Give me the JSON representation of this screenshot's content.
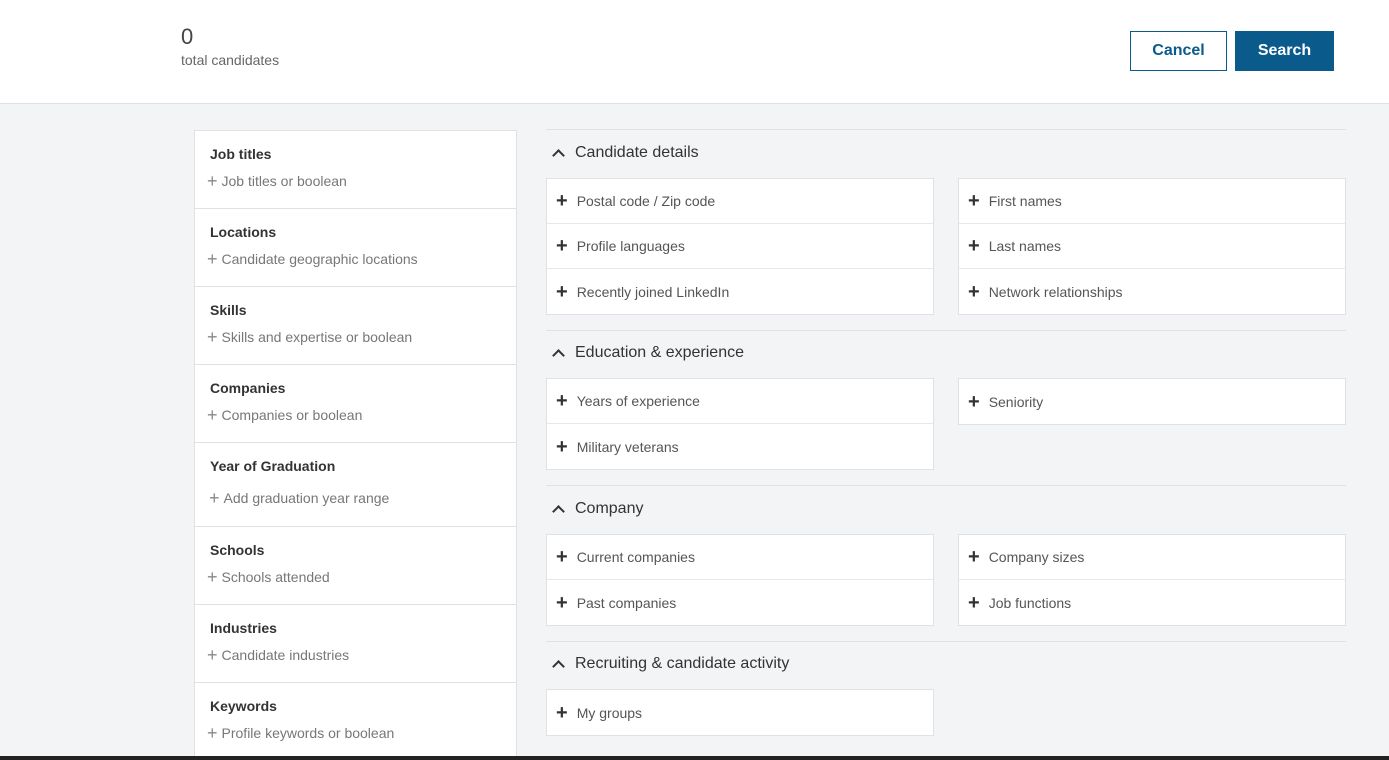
{
  "header": {
    "total_count": "0",
    "total_label": "total candidates",
    "cancel_label": "Cancel",
    "search_label": "Search"
  },
  "filters": [
    {
      "title": "Job titles",
      "placeholder": "Job titles or boolean"
    },
    {
      "title": "Locations",
      "placeholder": "Candidate geographic locations"
    },
    {
      "title": "Skills",
      "placeholder": "Skills and expertise or boolean"
    },
    {
      "title": "Companies",
      "placeholder": "Companies or boolean"
    },
    {
      "title": "Year of Graduation",
      "placeholder": "Add graduation year range"
    },
    {
      "title": "Schools",
      "placeholder": "Schools attended"
    },
    {
      "title": "Industries",
      "placeholder": "Candidate industries"
    },
    {
      "title": "Keywords",
      "placeholder": "Profile keywords or boolean"
    }
  ],
  "sections": {
    "candidate_details": {
      "title": "Candidate details",
      "left": [
        "Postal code / Zip code",
        "Profile languages",
        "Recently joined LinkedIn"
      ],
      "right": [
        "First names",
        "Last names",
        "Network relationships"
      ]
    },
    "education": {
      "title": "Education & experience",
      "left": [
        "Years of experience",
        "Military veterans"
      ],
      "right": [
        "Seniority"
      ]
    },
    "company": {
      "title": "Company",
      "left": [
        "Current companies",
        "Past companies"
      ],
      "right": [
        "Company sizes",
        "Job functions"
      ]
    },
    "recruiting": {
      "title": "Recruiting & candidate activity",
      "left": [
        "My groups"
      ]
    }
  },
  "colors": {
    "primary": "#0a5a8c",
    "background": "#f3f4f6",
    "border": "#dfe1e4"
  }
}
